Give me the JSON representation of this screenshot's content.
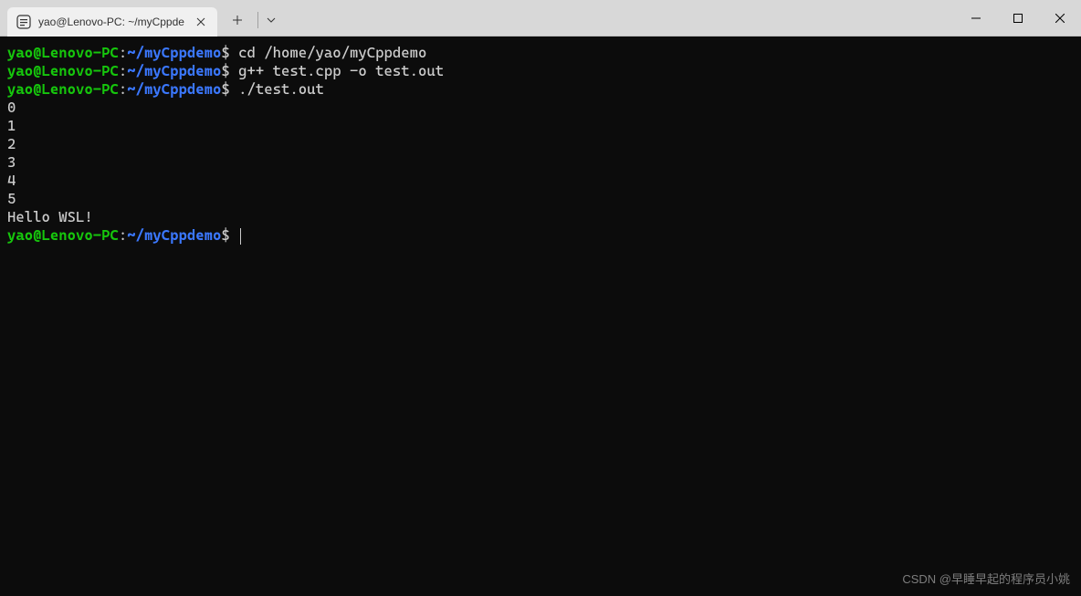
{
  "window": {
    "tab_title": "yao@Lenovo-PC: ~/myCppde",
    "tab_icon": "🐧"
  },
  "terminal": {
    "prompt_user": "yao@Lenovo-PC",
    "prompt_colon": ":",
    "prompt_path": "~/myCppdemo",
    "prompt_dollar": "$",
    "lines": [
      {
        "type": "prompt",
        "command": "cd /home/yao/myCppdemo"
      },
      {
        "type": "prompt",
        "command": "g++ test.cpp -o test.out"
      },
      {
        "type": "prompt",
        "command": "./test.out"
      },
      {
        "type": "output",
        "text": "0"
      },
      {
        "type": "output",
        "text": "1"
      },
      {
        "type": "output",
        "text": "2"
      },
      {
        "type": "output",
        "text": "3"
      },
      {
        "type": "output",
        "text": "4"
      },
      {
        "type": "output",
        "text": "5"
      },
      {
        "type": "output",
        "text": "Hello WSL!"
      },
      {
        "type": "prompt",
        "command": "",
        "cursor": true
      }
    ]
  },
  "watermark": "CSDN @早睡早起的程序员小姚"
}
